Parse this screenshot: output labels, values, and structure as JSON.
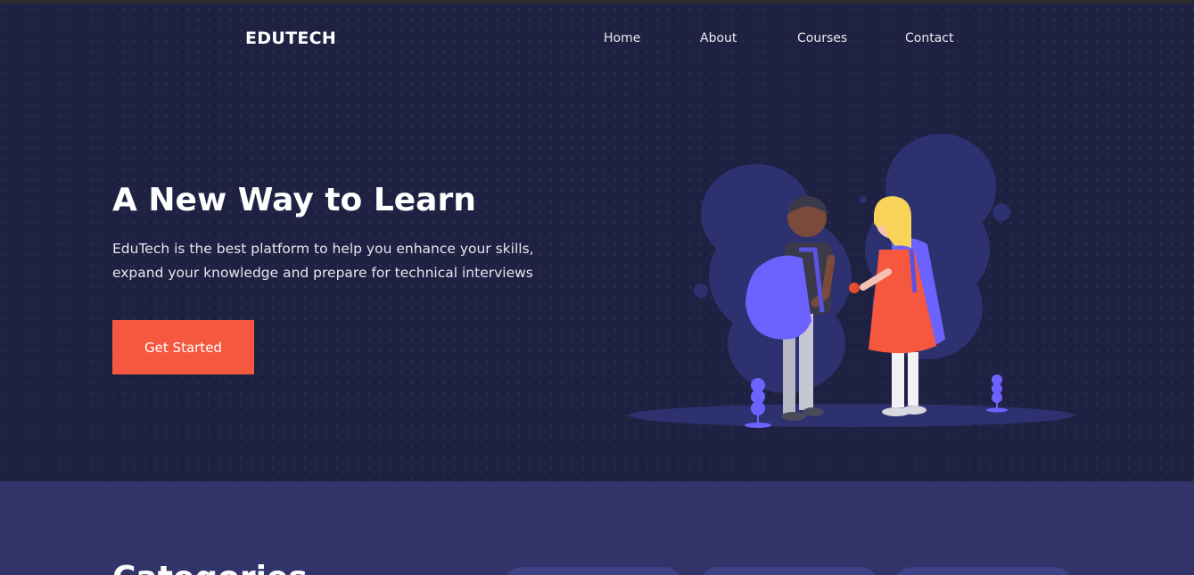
{
  "brand": {
    "name": "EDUTECH"
  },
  "nav": {
    "items": [
      "Home",
      "About",
      "Courses",
      "Contact"
    ]
  },
  "hero": {
    "title": "A New Way to Learn",
    "description": "EduTech is the best platform to help you enhance your skills, expand your knowledge and prepare for technical interviews",
    "cta_label": "Get Started"
  },
  "section": {
    "title": "Categories"
  },
  "colors": {
    "hero_bg": "#1e2141",
    "section_bg": "#323469",
    "accent": "#f5583f",
    "illustration_blob": "#2e3170",
    "backpack": "#6c63ff"
  },
  "icons": {
    "illustration": "students-with-backpacks-illustration"
  }
}
